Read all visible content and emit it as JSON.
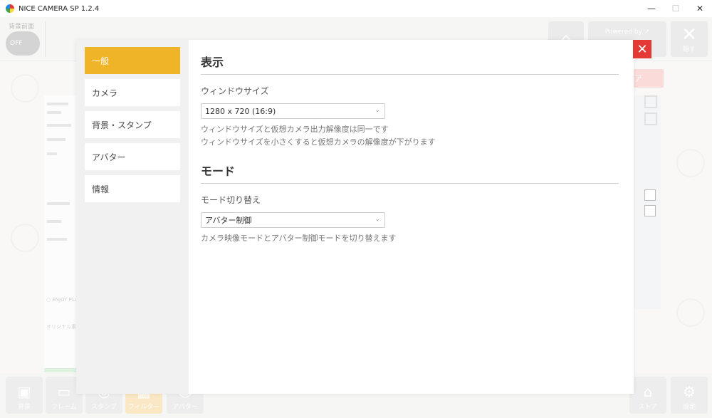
{
  "titlebar": {
    "title": "NICE CAMERA SP 1.2.4",
    "minimize": "—",
    "maximize": "☐",
    "close": "✕"
  },
  "background_app": {
    "bg_label": "背景前面",
    "toggle": "OFF",
    "home_icon": "⌂",
    "powered_by": "Powered by ↗",
    "close_label": "隠す",
    "close_icon": "✕",
    "store_text": "ア",
    "preview_texts": [
      "○ ENJOY PLAY!!",
      "オリジナル素"
    ],
    "bottom_bar": [
      {
        "icon": "▣",
        "label": "背景"
      },
      {
        "icon": "▭",
        "label": "フレーム"
      },
      {
        "icon": "◎",
        "label": "スタンプ"
      },
      {
        "icon": "▦",
        "label": "フィルター"
      },
      {
        "icon": "☺",
        "label": "アバター"
      },
      {
        "icon": "⌂",
        "label": "ストア"
      },
      {
        "icon": "⚙",
        "label": "設定"
      }
    ]
  },
  "dialog": {
    "close_icon": "✕",
    "nav": [
      "一般",
      "カメラ",
      "背景・スタンプ",
      "アバター",
      "情報"
    ],
    "active_nav": "一般",
    "display": {
      "title": "表示",
      "window_size_label": "ウィンドウサイズ",
      "window_size_value": "1280 x 720 (16:9)",
      "help1": "ウィンドウサイズと仮想カメラ出力解像度は同一です",
      "help2": "ウィンドウサイズを小さくすると仮想カメラの解像度が下がります"
    },
    "mode": {
      "title": "モード",
      "mode_switch_label": "モード切り替え",
      "mode_value": "アバター制御",
      "help": "カメラ映像モードとアバター制御モードを切り替えます"
    },
    "accent_color": "#f0b428",
    "close_color": "#e53935"
  }
}
